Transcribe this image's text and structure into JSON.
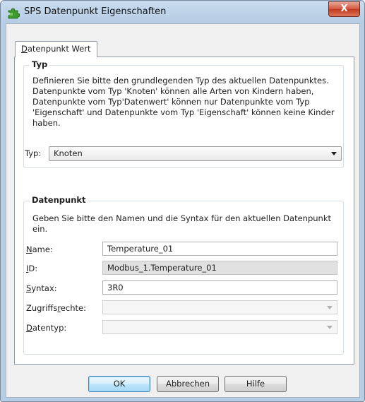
{
  "window": {
    "title": "SPS Datenpunkt Eigenschaften",
    "close_label": "X",
    "icon": "puzzle-icon"
  },
  "tab": {
    "label_accel": "D",
    "label_rest": "atenpunkt Wert"
  },
  "typ_group": {
    "title": "Typ",
    "description": "Definieren Sie bitte den grundlegenden Typ des aktuellen Datenpunktes. Datenpunkte vom Typ 'Knoten' können alle Arten von Kindern haben, Datenpunkte vom Typ'Datenwert' können nur Datenpunkte vom Typ 'Eigenschaft' und Datenpunkte vom Typ 'Eigenschaft' können keine Kinder haben.",
    "typ_label": "Typ:",
    "typ_value": "Knoten"
  },
  "datenpunkt_group": {
    "title": "Datenpunkt",
    "description": "Geben Sie bitte den Namen und die Syntax für den aktuellen Datenpunkt ein.",
    "name_label_accel": "N",
    "name_label_rest": "ame:",
    "name_value": "Temperature_01",
    "id_label_accel": "I",
    "id_label_rest": "D:",
    "id_value": "Modbus_1.Temperature_01",
    "syntax_label_accel": "S",
    "syntax_label_rest": "yntax:",
    "syntax_value": "3R0",
    "access_label_pre": "Zugriffs",
    "access_label_accel": "r",
    "access_label_rest": "echte:",
    "access_value": "",
    "datatype_label_accel": "D",
    "datatype_label_rest": "atentyp:",
    "datatype_value": ""
  },
  "buttons": {
    "ok": "OK",
    "cancel": "Abbrechen",
    "help": "Hilfe"
  },
  "colors": {
    "titlebar": "#b7cde4",
    "close": "#c2381f",
    "default_button": "#3c7fb1"
  }
}
